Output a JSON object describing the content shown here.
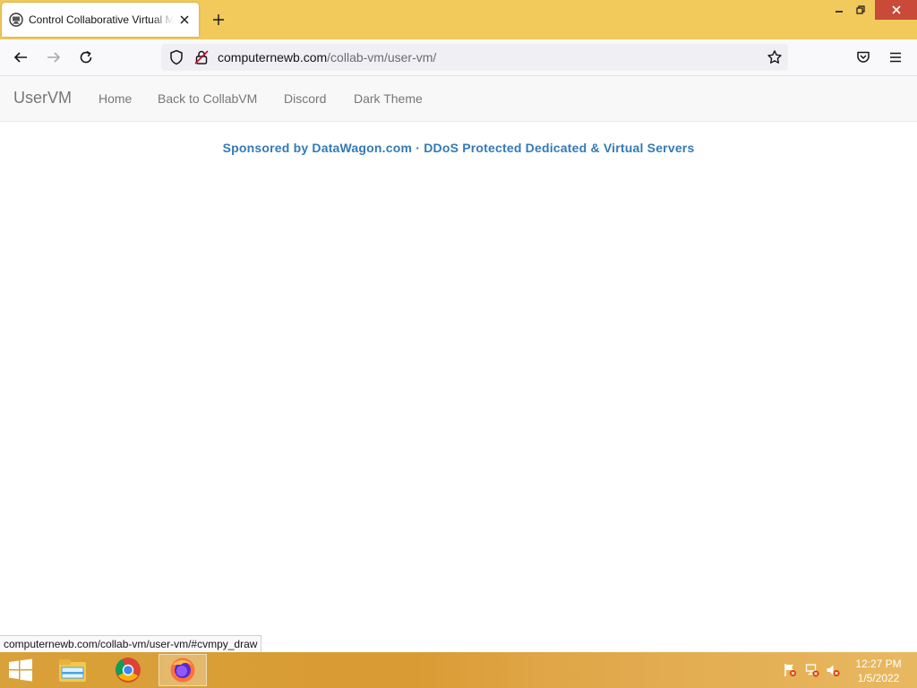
{
  "browser": {
    "tab": {
      "title": "Control Collaborative Virtual Machines",
      "favicon": "collabvm-favicon-icon"
    },
    "url": {
      "host": "computernewb.com",
      "path": "/collab-vm/user-vm/"
    },
    "status_link": "computernewb.com/collab-vm/user-vm/#cvmpy_draw",
    "accent_color": "#f2c95b"
  },
  "site": {
    "brand": "UserVM",
    "nav": [
      {
        "label": "Home"
      },
      {
        "label": "Back to CollabVM"
      },
      {
        "label": "Discord"
      },
      {
        "label": "Dark Theme"
      }
    ],
    "sponsor_text": "Sponsored by DataWagon.com · DDoS Protected Dedicated & Virtual Servers",
    "link_color": "#337ab7"
  },
  "taskbar": {
    "apps": [
      {
        "name": "file-explorer-icon"
      },
      {
        "name": "chrome-icon"
      },
      {
        "name": "firefox-icon"
      }
    ],
    "clock": {
      "time": "12:27 PM",
      "date": "1/5/2022"
    }
  }
}
